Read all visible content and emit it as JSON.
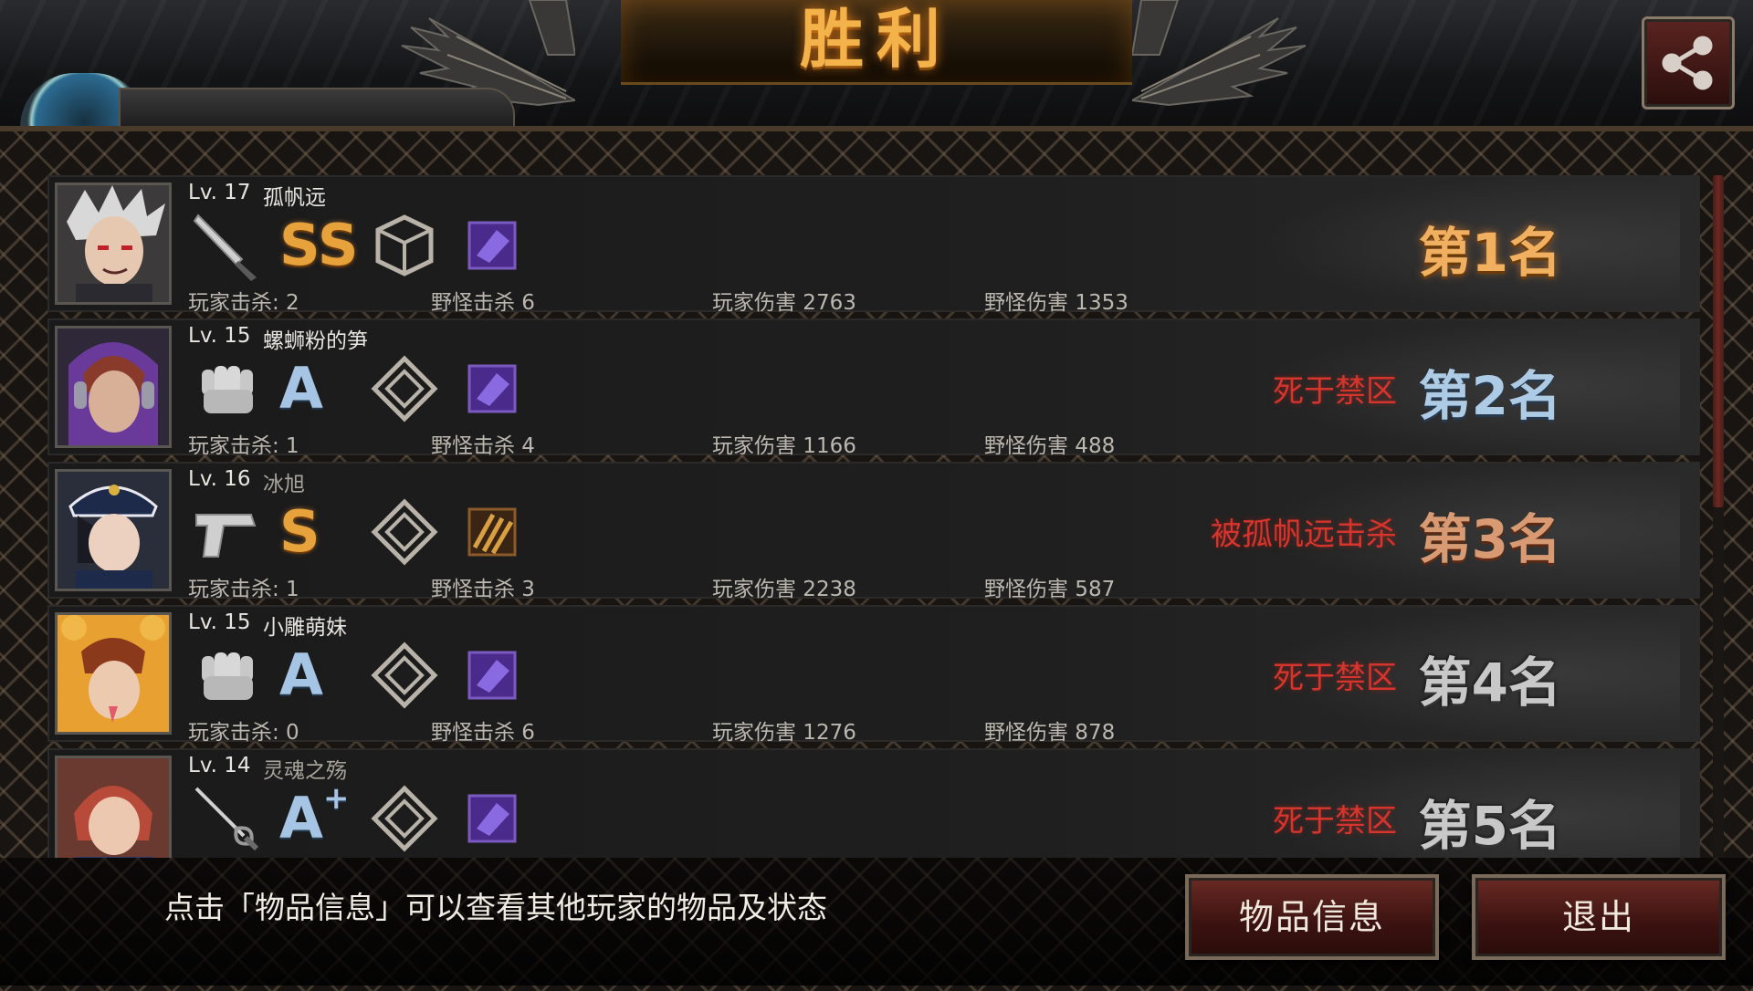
{
  "header": {
    "title": "胜利",
    "share_icon": "share-icon",
    "accent_color": "#f3b24a"
  },
  "players": [
    {
      "level": "Lv. 17",
      "name": "孤帆远",
      "name_style": "white",
      "weapon_icon": "knife-icon",
      "grade": "SS",
      "grade_color": "gold",
      "armor_icon": "cube-armor-icon",
      "item_icon": "purple-item-icon",
      "player_kills": "玩家击杀: 2",
      "monster_kills": "野怪击杀 6",
      "player_damage": "玩家伤害 2763",
      "monster_damage": "野怪伤害 1353",
      "death": "",
      "rank": "第1名"
    },
    {
      "level": "Lv. 15",
      "name": "螺蛳粉的笋",
      "name_style": "white",
      "weapon_icon": "fist-icon",
      "grade": "A",
      "grade_color": "blue",
      "armor_icon": "diamond-armor-icon",
      "item_icon": "purple-item-icon",
      "player_kills": "玩家击杀: 1",
      "monster_kills": "野怪击杀 4",
      "player_damage": "玩家伤害 1166",
      "monster_damage": "野怪伤害 488",
      "death": "死于禁区",
      "rank": "第2名"
    },
    {
      "level": "Lv. 16",
      "name": "冰旭",
      "name_style": "grey",
      "weapon_icon": "pistol-icon",
      "grade": "S",
      "grade_color": "gold",
      "armor_icon": "diamond-armor-icon",
      "item_icon": "ammo-item-icon",
      "player_kills": "玩家击杀: 1",
      "monster_kills": "野怪击杀 3",
      "player_damage": "玩家伤害 2238",
      "monster_damage": "野怪伤害 587",
      "death": "被孤帆远击杀",
      "rank": "第3名"
    },
    {
      "level": "Lv. 15",
      "name": "小雕萌妹",
      "name_style": "white",
      "weapon_icon": "fist-icon",
      "grade": "A",
      "grade_color": "blue",
      "armor_icon": "diamond-armor-icon",
      "item_icon": "purple-item-icon",
      "player_kills": "玩家击杀: 0",
      "monster_kills": "野怪击杀 6",
      "player_damage": "玩家伤害 1276",
      "monster_damage": "野怪伤害 878",
      "death": "死于禁区",
      "rank": "第4名"
    },
    {
      "level": "Lv. 14",
      "name": "灵魂之殇",
      "name_style": "grey",
      "weapon_icon": "rapier-icon",
      "grade": "A",
      "grade_plus": "+",
      "grade_color": "blue",
      "armor_icon": "diamond-armor-icon",
      "item_icon": "purple-item-icon",
      "player_kills": "",
      "monster_kills": "",
      "player_damage": "",
      "monster_damage": "",
      "death": "死于禁区",
      "rank": "第5名"
    }
  ],
  "footer": {
    "hint": "点击「物品信息」可以查看其他玩家的物品及状态",
    "info_button": "物品信息",
    "exit_button": "退出"
  }
}
